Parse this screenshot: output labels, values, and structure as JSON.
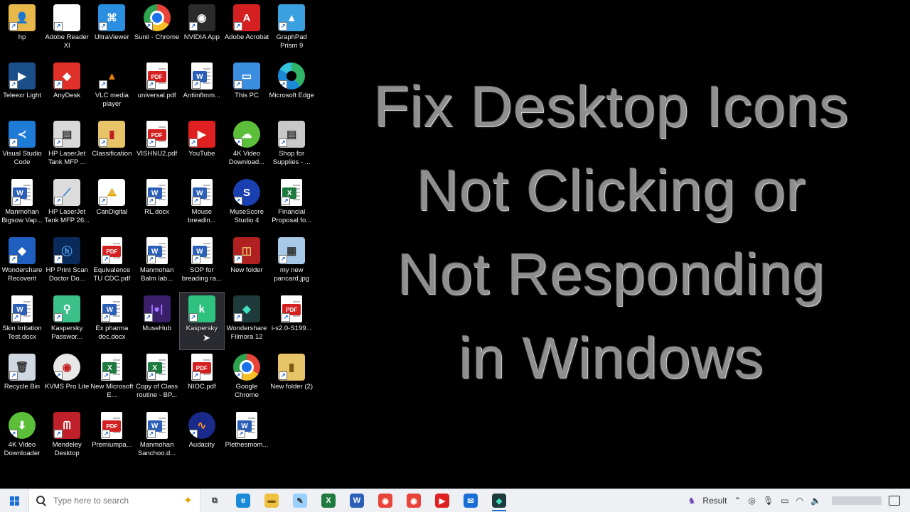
{
  "desktop_icons": [
    {
      "label": "hp",
      "icon": "folder-user-icon",
      "col": 0,
      "row": 0,
      "bg": "#e8b84a",
      "glyph": "👤"
    },
    {
      "label": "Adobe Reader XI",
      "icon": "file-icon",
      "col": 1,
      "row": 0,
      "bg": "#ffffff",
      "glyph": ""
    },
    {
      "label": "UltraViewer",
      "icon": "ultraviewer-icon",
      "col": 2,
      "row": 0,
      "bg": "#2a8fe0",
      "glyph": "⌘"
    },
    {
      "label": "Sunil - Chrome",
      "icon": "chrome-icon",
      "col": 3,
      "row": 0,
      "bg": "chrome",
      "glyph": ""
    },
    {
      "label": "NVIDIA App",
      "icon": "nvidia-icon",
      "col": 4,
      "row": 0,
      "bg": "#2b2b2b",
      "glyph": "◉"
    },
    {
      "label": "Adobe Acrobat",
      "icon": "acrobat-icon",
      "col": 5,
      "row": 0,
      "bg": "#d42020",
      "glyph": "A"
    },
    {
      "label": "GraphPad Prism 9",
      "icon": "graphpad-icon",
      "col": 6,
      "row": 0,
      "bg": "#3aa0e0",
      "glyph": "▲"
    },
    {
      "label": "Teleexr Light",
      "icon": "teleexr-icon",
      "col": 0,
      "row": 1,
      "bg": "#1b4f8a",
      "glyph": "▶"
    },
    {
      "label": "AnyDesk",
      "icon": "anydesk-icon",
      "col": 1,
      "row": 1,
      "bg": "#e0302a",
      "glyph": "◆"
    },
    {
      "label": "VLC media player",
      "icon": "vlc-icon",
      "col": 2,
      "row": 1,
      "bg": "#000000",
      "glyph": "▲",
      "color": "#f08000"
    },
    {
      "label": "universal.pdf",
      "icon": "pdf-file-icon",
      "col": 3,
      "row": 1,
      "doc": "PDF",
      "badge": "#d42020"
    },
    {
      "label": "Antiinflmm...",
      "icon": "word-file-icon",
      "col": 4,
      "row": 1,
      "doc": "W",
      "badge": "#2b5fb8"
    },
    {
      "label": "This PC",
      "icon": "this-pc-icon",
      "col": 5,
      "row": 1,
      "bg": "#3b8de0",
      "glyph": "▭"
    },
    {
      "label": "Microsoft Edge",
      "icon": "edge-icon",
      "col": 6,
      "row": 1,
      "bg": "edge",
      "glyph": ""
    },
    {
      "label": "Visual Studio Code",
      "icon": "vscode-icon",
      "col": 0,
      "row": 2,
      "bg": "#1e7bd6",
      "glyph": "≺"
    },
    {
      "label": "HP LaserJet Tank MFP ...",
      "icon": "printer-icon",
      "col": 1,
      "row": 2,
      "bg": "#d9d9d9",
      "glyph": "▤",
      "color": "#333"
    },
    {
      "label": "Classification",
      "icon": "folder-icon",
      "col": 2,
      "row": 2,
      "bg": "#e8c468",
      "glyph": "▮",
      "color": "#c02020"
    },
    {
      "label": "VISHNU2.pdf",
      "icon": "pdf-file-icon",
      "col": 3,
      "row": 2,
      "doc": "PDF",
      "badge": "#d42020"
    },
    {
      "label": "YouTube",
      "icon": "youtube-icon",
      "col": 4,
      "row": 2,
      "bg": "#e02020",
      "glyph": "▶"
    },
    {
      "label": "4K Video Download...",
      "icon": "4k-video-icon",
      "col": 5,
      "row": 2,
      "bg": "#5cbf3a",
      "glyph": "☁",
      "round": true
    },
    {
      "label": "Shop for Supplies - ...",
      "icon": "shop-printer-icon",
      "col": 6,
      "row": 2,
      "bg": "#c8c8c8",
      "glyph": "▤",
      "color": "#333"
    },
    {
      "label": "Manmohan Bigsow Vap...",
      "icon": "word-file-icon",
      "col": 0,
      "row": 3,
      "doc": "W",
      "badge": "#2b5fb8"
    },
    {
      "label": "HP LaserJet Tank MFP 26...",
      "icon": "scanner-icon",
      "col": 1,
      "row": 3,
      "bg": "#dcdcdc",
      "glyph": "⟋",
      "color": "#1a6fd6"
    },
    {
      "label": "CanDigital",
      "icon": "candigital-icon",
      "col": 2,
      "row": 3,
      "bg": "#ffffff",
      "glyph": "⟁",
      "color": "#e0a000"
    },
    {
      "label": "RL.docx",
      "icon": "word-file-icon",
      "col": 3,
      "row": 3,
      "doc": "W",
      "badge": "#2b5fb8"
    },
    {
      "label": "Mouse breadin...",
      "icon": "word-file-icon",
      "col": 4,
      "row": 3,
      "doc": "W",
      "badge": "#2b5fb8"
    },
    {
      "label": "MuseScore Studio 4",
      "icon": "musescore-icon",
      "col": 5,
      "row": 3,
      "bg": "#1a3fb0",
      "glyph": "S",
      "round": true
    },
    {
      "label": "Financial Proposal fo...",
      "icon": "excel-file-icon",
      "col": 6,
      "row": 3,
      "doc": "X",
      "badge": "#1e7a3e"
    },
    {
      "label": "Wondershare Recoverit",
      "icon": "recoverit-icon",
      "col": 0,
      "row": 4,
      "bg": "#1f5fc0",
      "glyph": "◆"
    },
    {
      "label": "HP Print Scan Doctor Do...",
      "icon": "hp-doctor-icon",
      "col": 1,
      "row": 4,
      "bg": "#0a2a5a",
      "glyph": "ⓗ",
      "color": "#4fa8ff"
    },
    {
      "label": "Equivalence TU CDC.pdf",
      "icon": "pdf-file-icon",
      "col": 2,
      "row": 4,
      "doc": "PDF",
      "badge": "#d42020"
    },
    {
      "label": "Manmohan Balm lab...",
      "icon": "word-file-icon",
      "col": 3,
      "row": 4,
      "doc": "W",
      "badge": "#2b5fb8"
    },
    {
      "label": "SOP for breading ra...",
      "icon": "word-file-icon",
      "col": 4,
      "row": 4,
      "doc": "W",
      "badge": "#2b5fb8"
    },
    {
      "label": "New folder",
      "icon": "folder-red-icon",
      "col": 5,
      "row": 4,
      "bg": "#b02020",
      "glyph": "◫",
      "color": "#e8c468"
    },
    {
      "label": "my new pancard.jpg",
      "icon": "image-file-icon",
      "col": 6,
      "row": 4,
      "bg": "#a8c8e8",
      "glyph": "▦",
      "color": "#333"
    },
    {
      "label": "Skin Irritation Test.docx",
      "icon": "word-file-icon",
      "col": 0,
      "row": 5,
      "doc": "W",
      "badge": "#2b5fb8"
    },
    {
      "label": "Kaspersky Passwor...",
      "icon": "kaspersky-password-icon",
      "col": 1,
      "row": 5,
      "bg": "#3cc08a",
      "glyph": "⚲"
    },
    {
      "label": "Ex pharma doc.docx",
      "icon": "word-file-icon",
      "col": 2,
      "row": 5,
      "doc": "W",
      "badge": "#2b5fb8"
    },
    {
      "label": "MuseHub",
      "icon": "musehub-icon",
      "col": 3,
      "row": 5,
      "bg": "#3a1f6a",
      "glyph": "|●|",
      "color": "#a070ff"
    },
    {
      "label": "Kaspersky",
      "icon": "kaspersky-icon",
      "col": 4,
      "row": 5,
      "bg": "#2ec27e",
      "glyph": "k",
      "selected": true
    },
    {
      "label": "Wondershare Filmora 12",
      "icon": "filmora-icon",
      "col": 5,
      "row": 5,
      "bg": "#1f3a3a",
      "glyph": "◆",
      "color": "#3fe0c0"
    },
    {
      "label": "i-s2.0-S199...",
      "icon": "pdf-file-icon",
      "col": 6,
      "row": 5,
      "doc": "PDF",
      "badge": "#d42020"
    },
    {
      "label": "Recycle Bin",
      "icon": "recycle-bin-icon",
      "col": 0,
      "row": 6,
      "bg": "#cfd8e0",
      "glyph": "🗑",
      "color": "#333"
    },
    {
      "label": "KVMS Pro Lite",
      "icon": "kvms-icon",
      "col": 1,
      "row": 6,
      "bg": "#e8e8e8",
      "glyph": "◉",
      "color": "#c02020",
      "round": true
    },
    {
      "label": "New Microsoft E...",
      "icon": "excel-file-icon",
      "col": 2,
      "row": 6,
      "doc": "X",
      "badge": "#1e7a3e"
    },
    {
      "label": "Copy of Class routine - BP...",
      "icon": "excel-file-icon",
      "col": 3,
      "row": 6,
      "doc": "X",
      "badge": "#1e7a3e"
    },
    {
      "label": "NIOC.pdf",
      "icon": "pdf-file-icon",
      "col": 4,
      "row": 6,
      "doc": "PDF",
      "badge": "#d42020"
    },
    {
      "label": "Google Chrome",
      "icon": "chrome-icon",
      "col": 5,
      "row": 6,
      "bg": "chrome",
      "glyph": ""
    },
    {
      "label": "New folder (2)",
      "icon": "folder-icon",
      "col": 6,
      "row": 6,
      "bg": "#e8c468",
      "glyph": "▮",
      "color": "#7a5a10"
    },
    {
      "label": "4K Video Downloader",
      "icon": "4k-downloader-icon",
      "col": 0,
      "row": 7,
      "bg": "#5cbf3a",
      "glyph": "⬇",
      "round": true
    },
    {
      "label": "Mendeley Desktop",
      "icon": "mendeley-icon",
      "col": 1,
      "row": 7,
      "bg": "#c0202a",
      "glyph": "ᗰ"
    },
    {
      "label": "Premiumpa...",
      "icon": "pdf-file-icon",
      "col": 2,
      "row": 7,
      "doc": "PDF",
      "badge": "#d42020"
    },
    {
      "label": "Manmohan Sanchoo.d...",
      "icon": "word-file-icon",
      "col": 3,
      "row": 7,
      "doc": "W",
      "badge": "#2b5fb8"
    },
    {
      "label": "Audacity",
      "icon": "audacity-icon",
      "col": 4,
      "row": 7,
      "bg": "#1a2a8a",
      "glyph": "∿",
      "color": "#ff9020",
      "round": true
    },
    {
      "label": "Plethesmom...",
      "icon": "word-file-icon",
      "col": 5,
      "row": 7,
      "doc": "W",
      "badge": "#2b5fb8"
    }
  ],
  "headline": {
    "line1": "Fix Desktop Icons",
    "line2": "Not Clicking or",
    "line3": "Not Responding",
    "line4": "in Windows"
  },
  "taskbar": {
    "search_placeholder": "Type here to search",
    "apps": [
      {
        "name": "task-view-icon",
        "bg": "transparent",
        "glyph": "⧉",
        "color": "#333"
      },
      {
        "name": "edge-icon",
        "bg": "#1a8ad8",
        "glyph": "e"
      },
      {
        "name": "file-explorer-icon",
        "bg": "#f0c040",
        "glyph": "▬",
        "color": "#7a5a10"
      },
      {
        "name": "notepad-icon",
        "bg": "#9ad0ff",
        "glyph": "✎",
        "color": "#333"
      },
      {
        "name": "excel-icon",
        "bg": "#1e7a3e",
        "glyph": "X"
      },
      {
        "name": "word-icon",
        "bg": "#2b5fb8",
        "glyph": "W"
      },
      {
        "name": "chrome-icon",
        "bg": "#e8443a",
        "glyph": "◉"
      },
      {
        "name": "chrome-profile-icon",
        "bg": "#e8443a",
        "glyph": "◉"
      },
      {
        "name": "youtube-icon",
        "bg": "#e02020",
        "glyph": "▶"
      },
      {
        "name": "mail-icon",
        "bg": "#1a6fd6",
        "glyph": "✉"
      },
      {
        "name": "filmora-icon",
        "bg": "#1f3a3a",
        "glyph": "◆",
        "color": "#3fe0c0",
        "active": true
      }
    ],
    "tray_label": "Result"
  }
}
